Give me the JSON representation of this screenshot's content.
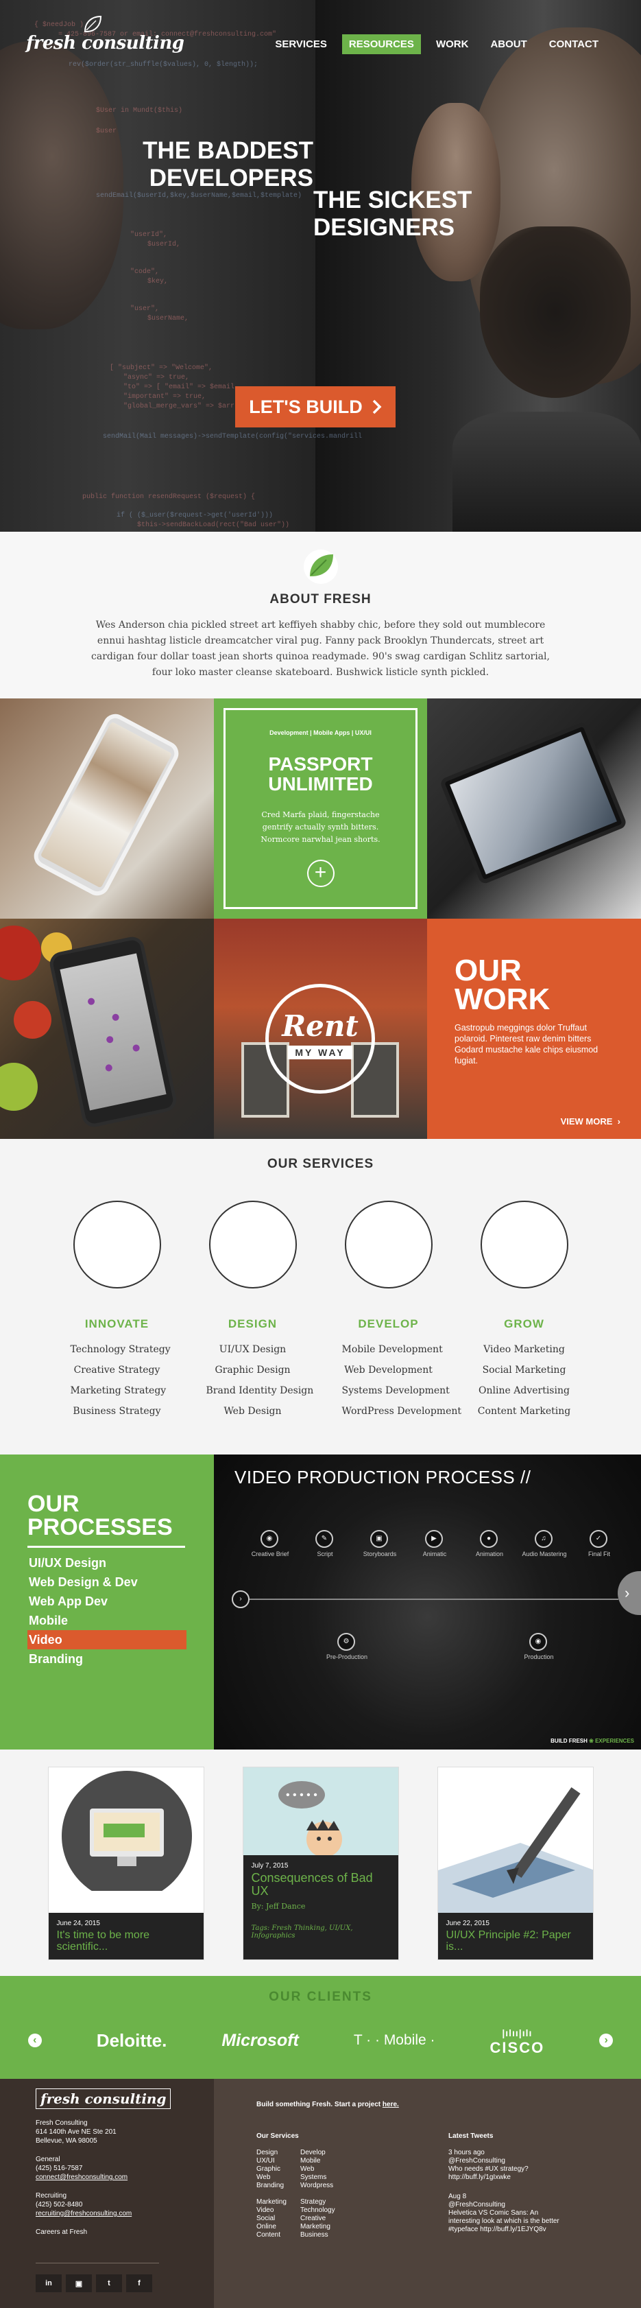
{
  "brand": {
    "name": "fresh consulting",
    "accent_green": "#6db34a",
    "accent_orange": "#db5a2d"
  },
  "nav": {
    "items": [
      {
        "label": "SERVICES",
        "active": false
      },
      {
        "label": "RESOURCES",
        "active": true
      },
      {
        "label": "WORK",
        "active": false
      },
      {
        "label": "ABOUT",
        "active": false
      },
      {
        "label": "CONTACT",
        "active": false
      }
    ]
  },
  "hero": {
    "line1": "THE BADDEST DEVELOPERS",
    "line2": "THE SICKEST DESIGNERS",
    "cta_label": "LET'S BUILD",
    "cta_icon": "chevron-right-icon",
    "code_lines": [
      "{ $needJob )",
      "= 425-896-7587 or email: connect@freshconsulting.com\"",
      "rev($order(str_shuffle($values), 0, $length));",
      "$User in Mundt($this)",
      "$user",
      "sendEmail($userId,$key,$userName,$email,$template)",
      "\"userId\",",
      "$userId,",
      "\"code\",",
      "$key,",
      "\"user\",",
      "$userName,",
      "[ \"subject\" => \"Welcome\",",
      "\"async\" => true,",
      "\"to\" => [ \"email\" => $email",
      "\"important\" => true,",
      "\"global_merge_vars\" => $arr",
      "sendMail(Mail messages)->sendTemplate(config(\"services.mandrill",
      "public function resendRequest ($request) {",
      "if ( ($_user($request->get('userId')))",
      "$this->sendBackLoad(rect(\"Bad user\"))"
    ]
  },
  "about": {
    "icon": "leaf-icon",
    "title": "ABOUT FRESH",
    "body": "Wes Anderson chia pickled street art keffiyeh shabby chic, before they sold out mumblecore ennui hashtag listicle dreamcatcher viral pug. Fanny pack Brooklyn Thundercats, street art cardigan four dollar toast jean shorts quinoa readymade. 90's swag cardigan Schlitz sartorial, four loko master cleanse skateboard. Bushwick listicle synth pickled."
  },
  "work": {
    "feature": {
      "tags": "Development | Mobile Apps | UX/UI",
      "title": "PASSPORT UNLIMITED",
      "body": "Cred Marfa plaid, fingerstache gentrify actually synth bitters. Normcore narwhal jean shorts.",
      "action_icon": "plus-icon"
    },
    "rent_badge": {
      "top": "Rent",
      "bottom": "MY WAY"
    },
    "cta": {
      "title": "OUR WORK",
      "body": "Gastropub meggings dolor Truffaut polaroid. Pinterest raw denim bitters Godard mustache kale chips eiusmod fugiat.",
      "more_label": "VIEW MORE",
      "more_icon": "chevron-right-icon"
    }
  },
  "services": {
    "title": "OUR SERVICES",
    "columns": [
      {
        "heading": "INNOVATE",
        "items": [
          "Technology Strategy",
          "Creative Strategy",
          "Marketing Strategy",
          "Business Strategy"
        ]
      },
      {
        "heading": "DESIGN",
        "items": [
          "UI/UX Design",
          "Graphic Design",
          "Brand Identity Design",
          "Web Design"
        ]
      },
      {
        "heading": "DEVELOP",
        "items": [
          "Mobile Development",
          "Web Development",
          "Systems Development",
          "WordPress Development"
        ]
      },
      {
        "heading": "GROW",
        "items": [
          "Video Marketing",
          "Social Marketing",
          "Online Advertising",
          "Content Marketing"
        ]
      }
    ]
  },
  "processes": {
    "title_line1": "OUR",
    "title_line2": "PROCESSES",
    "items": [
      {
        "label": "UI/UX Design",
        "active": false
      },
      {
        "label": "Web Design & Dev",
        "active": false
      },
      {
        "label": "Web App Dev",
        "active": false
      },
      {
        "label": "Mobile",
        "active": false
      },
      {
        "label": "Video",
        "active": true
      },
      {
        "label": "Branding",
        "active": false
      }
    ],
    "video": {
      "title": "VIDEO PRODUCTION PROCESS //",
      "steps_top": [
        "Creative Brief",
        "Script",
        "Storyboards",
        "Animatic",
        "Animation",
        "Audio Mastering",
        "Final Fit"
      ],
      "steps_bottom": [
        "Pre-Production",
        "Production"
      ],
      "footer_left": "BUILD FRESH",
      "footer_right": "EXPERIENCES",
      "next_icon": "chevron-right-icon"
    }
  },
  "blog": {
    "posts": [
      {
        "date": "June 24, 2015",
        "title": "It's time to be more scientific...",
        "by": "",
        "tags": ""
      },
      {
        "date": "July 7, 2015",
        "title": "Consequences of Bad UX",
        "by": "By: Jeff Dance",
        "tags": "Tags: Fresh Thinking, UI/UX, Infographics"
      },
      {
        "date": "June 22, 2015",
        "title": "UI/UX Principle #2: Paper is...",
        "by": "",
        "tags": ""
      }
    ]
  },
  "clients": {
    "title": "OUR CLIENTS",
    "prev_icon": "chevron-left-icon",
    "next_icon": "chevron-right-icon",
    "logos": [
      "Deloitte.",
      "Microsoft",
      "T · · Mobile ·",
      "CISCO"
    ]
  },
  "footer": {
    "logo": "fresh consulting",
    "address": [
      "Fresh Consulting",
      "614 140th Ave NE Ste 201",
      "Bellevue, WA 98005"
    ],
    "general_label": "General",
    "general_phone": "(425) 516-7587",
    "general_email": "connect@freshconsulting.com",
    "recruiting_label": "Recruiting",
    "recruiting_phone": "(425) 502-8480",
    "recruiting_email": "recruiting@freshconsulting.com",
    "careers": "Careers at Fresh",
    "social": [
      "in",
      "▣",
      "t",
      "f"
    ],
    "lead_text": "Build something Fresh. Start a project",
    "lead_link": "here.",
    "services_heading": "Our Services",
    "services_col1": [
      "Design",
      "UX/UI",
      "Graphic",
      "Web",
      "Branding",
      "",
      "Marketing",
      "Video",
      "Social",
      "Online",
      "Content"
    ],
    "services_col2": [
      "Develop",
      "Mobile",
      "Web",
      "Systems",
      "Wordpress",
      "",
      "Strategy",
      "Technology",
      "Creative",
      "Marketing",
      "Business"
    ],
    "tweets_heading": "Latest Tweets",
    "tweets": [
      {
        "time": "3 hours ago",
        "handle": "@FreshConsulting",
        "text": "Who needs #UX strategy? http://buff.ly/1gIxwke"
      },
      {
        "time": "Aug 8",
        "handle": "@FreshConsulting",
        "text": "Helvetica VS Comic Sans: An interesting look at which is the better #typeface http://buff.ly/1EJYQ8v"
      }
    ]
  }
}
